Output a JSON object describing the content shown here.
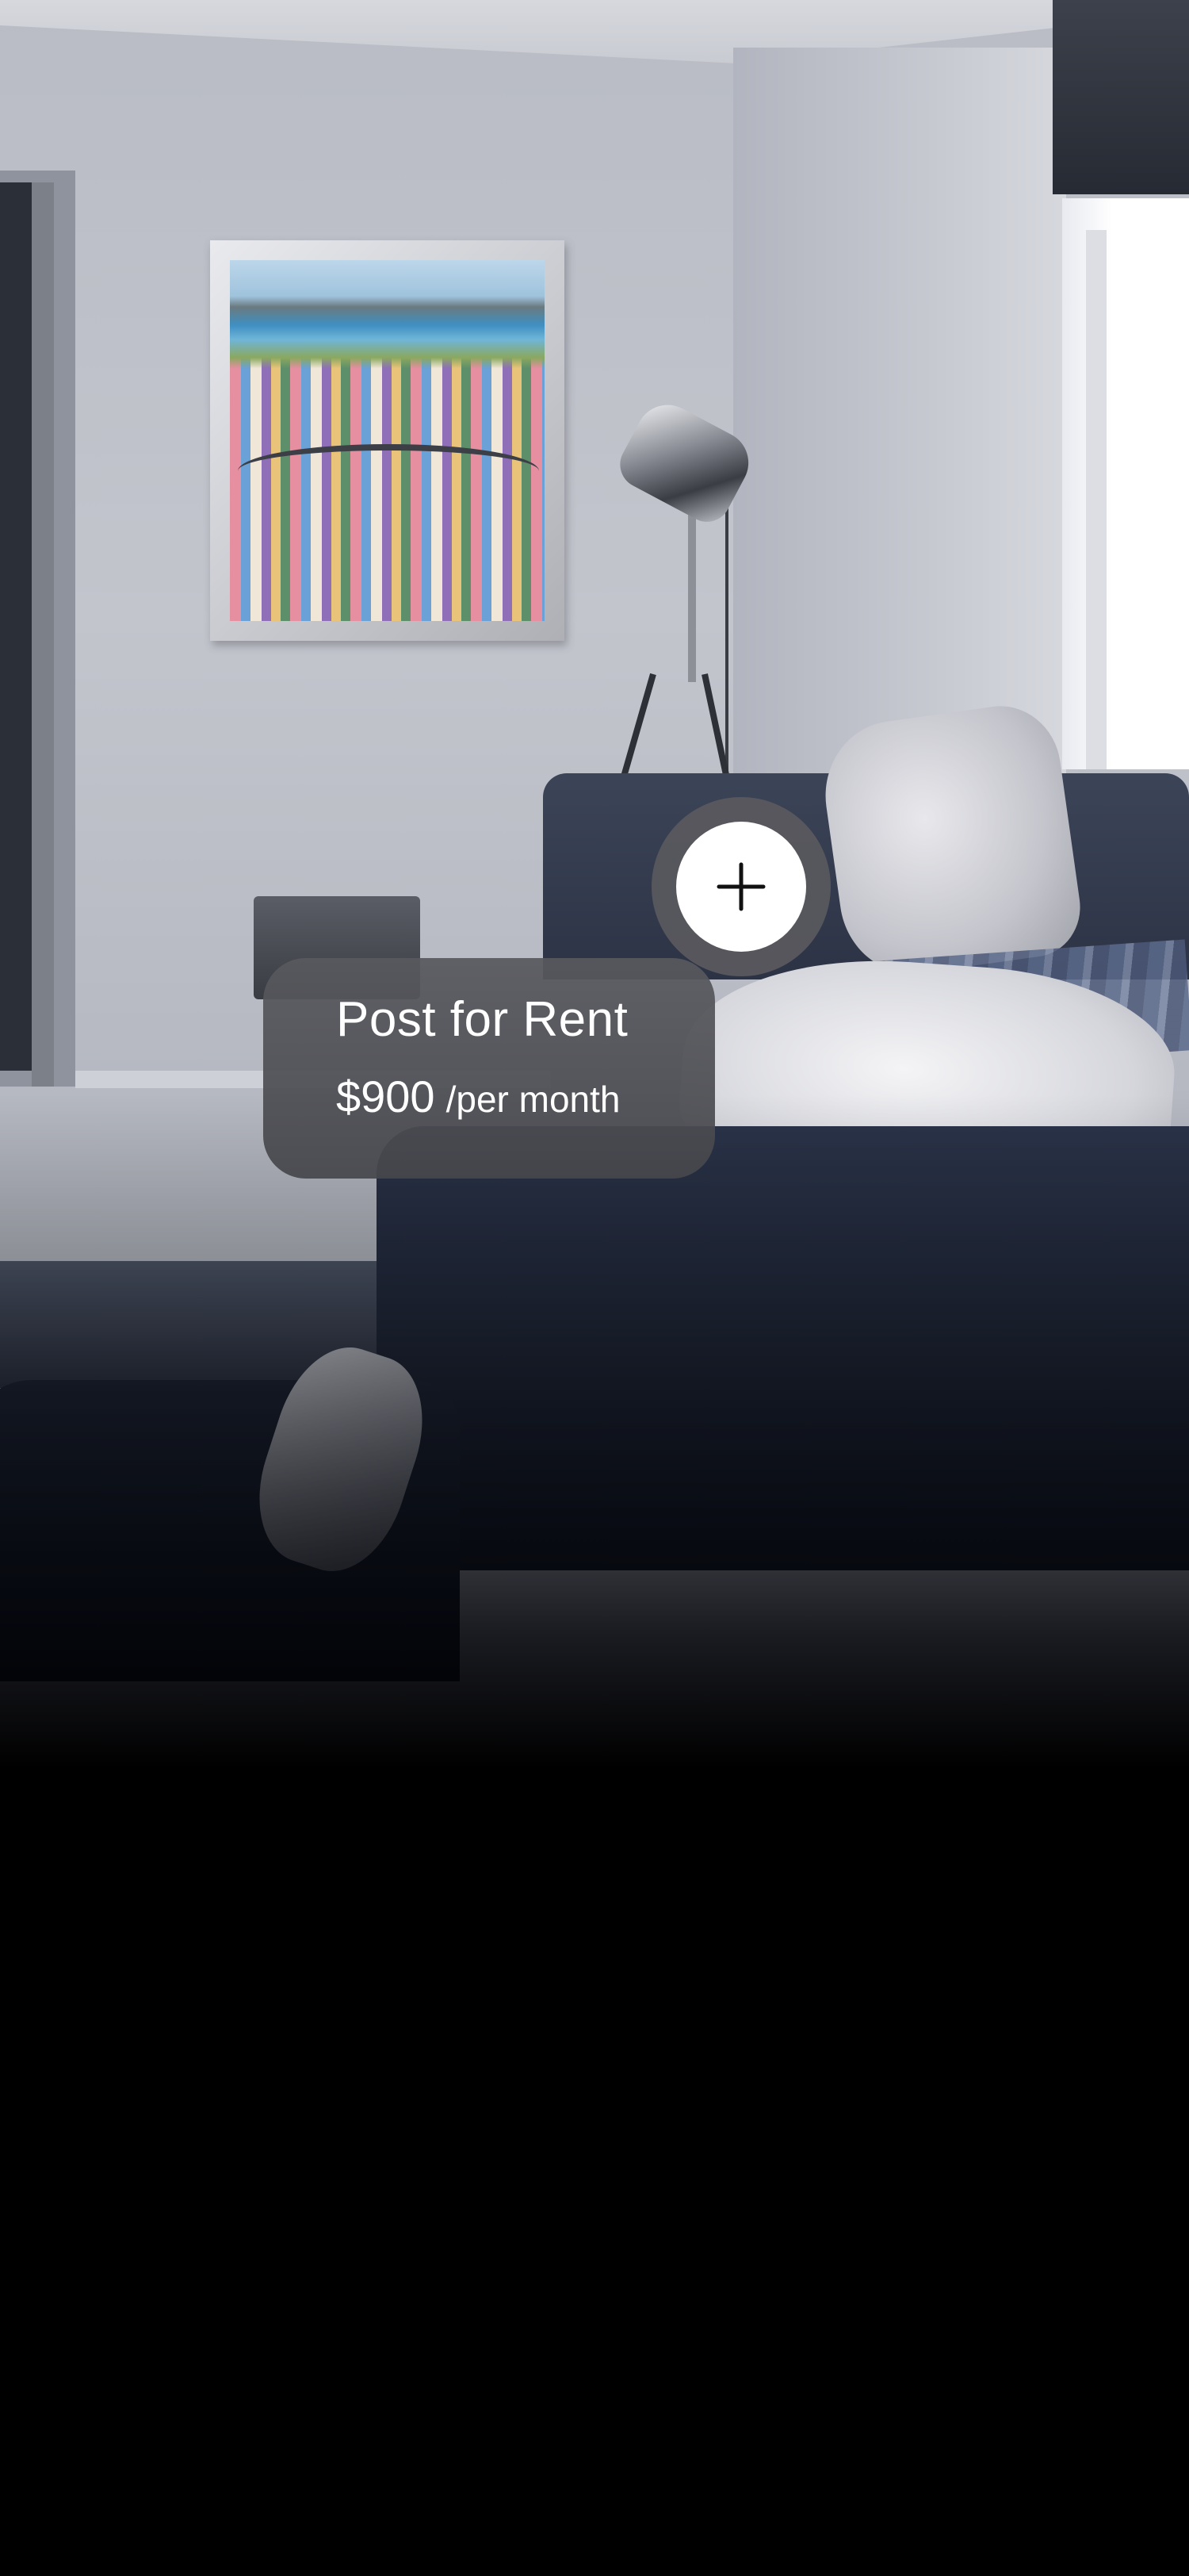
{
  "listing": {
    "title": "Post for Rent",
    "price": "$900",
    "price_unit": "/per month"
  },
  "actions": {
    "add_icon": "plus-icon"
  },
  "colors": {
    "card_background": "#58595e",
    "button_background": "#ffffff",
    "icon_color": "#111111",
    "text_color": "#ffffff",
    "screen_background": "#000000"
  }
}
